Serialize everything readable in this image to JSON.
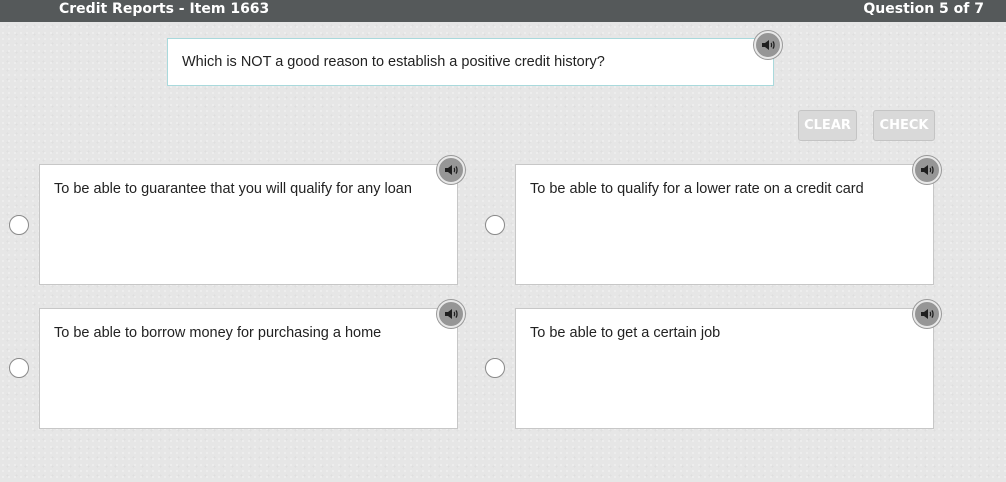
{
  "header": {
    "title": "Credit Reports - Item 1663",
    "progress": "Question 5 of 7"
  },
  "question": {
    "text": "Which is NOT a good reason to establish a positive credit history?",
    "audio_icon": "speaker-icon"
  },
  "buttons": {
    "clear_label": "CLEAR",
    "check_label": "CHECK",
    "enabled": false
  },
  "choices": [
    {
      "text": "To be able to guarantee that you will qualify for any loan",
      "selected": false
    },
    {
      "text": "To be able to qualify for a lower rate on a credit card",
      "selected": false
    },
    {
      "text": "To be able to borrow money for purchasing a home",
      "selected": false
    },
    {
      "text": "To be able to get a certain job",
      "selected": false
    }
  ],
  "colors": {
    "header_bg": "#55595a",
    "page_bg": "#e6e6e6",
    "question_border": "#a9d9dc",
    "audio_button": "#969696",
    "disabled_button": "#d9d9d9"
  }
}
